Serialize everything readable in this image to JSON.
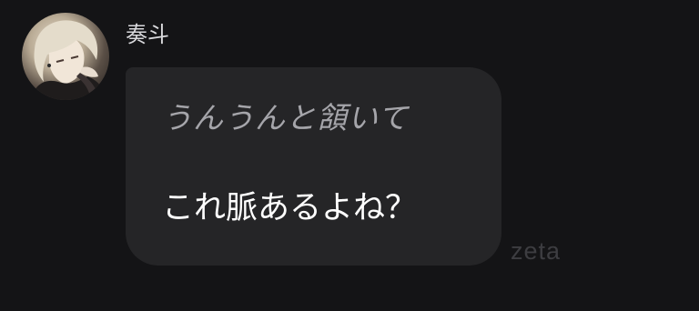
{
  "message": {
    "sender": {
      "name": "奏斗",
      "avatar_icon": "anime-character-avatar"
    },
    "bubble": {
      "action_text": "うんうんと頷いて",
      "speech_text": "これ脈あるよね？"
    }
  },
  "watermark": {
    "text": "zeta"
  },
  "colors": {
    "background": "#141416",
    "bubble": "#252527",
    "action_text": "#a5a5aa",
    "speech_text": "#ffffff",
    "watermark": "#3d3d41"
  }
}
